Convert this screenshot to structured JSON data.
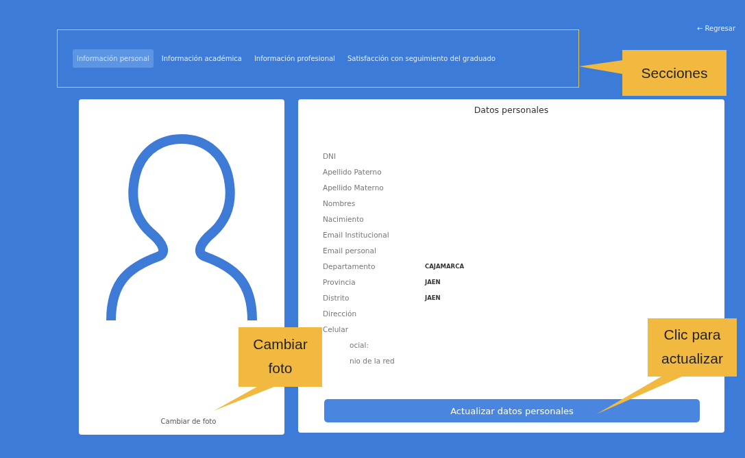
{
  "header": {
    "tabs": [
      {
        "label": "Información personal",
        "selected": true
      },
      {
        "label": "Información académica",
        "selected": false
      },
      {
        "label": "Información profesional",
        "selected": false
      },
      {
        "label": "Satisfacción con seguimiento del graduado",
        "selected": false
      }
    ],
    "back_link": "← Regresar"
  },
  "photo_panel": {
    "change_photo_link": "Cambiar de foto"
  },
  "personal_data": {
    "title": "Datos personales",
    "fields": [
      {
        "label": "DNI",
        "kind": "plain"
      },
      {
        "label": "Apellido Paterno",
        "kind": "plain"
      },
      {
        "label": "Apellido Materno",
        "kind": "plain"
      },
      {
        "label": "Nombres",
        "kind": "plain"
      },
      {
        "label": "Nacimiento",
        "kind": "plain"
      },
      {
        "label": "Email Institucional",
        "kind": "plain"
      },
      {
        "label": "Email personal",
        "kind": "plain"
      },
      {
        "label": "Departamento",
        "value": "CAJAMARCA",
        "kind": "plain"
      },
      {
        "label": "Provincia",
        "value": "JAEN",
        "kind": "plain"
      },
      {
        "label": "Distrito",
        "value": "JAEN",
        "kind": "plain"
      },
      {
        "label": "Dirección",
        "kind": "plain"
      },
      {
        "label": "Celular",
        "kind": "plain"
      },
      {
        "label": "ocial:",
        "kind": "partial"
      },
      {
        "label": "nio de la red",
        "kind": "partial"
      }
    ],
    "submit_button": "Actualizar datos personales"
  },
  "callouts": [
    {
      "lines": [
        "Secciones"
      ]
    },
    {
      "lines": [
        "Cambiar",
        "foto"
      ]
    },
    {
      "lines": [
        "Clic para",
        "actualizar"
      ]
    }
  ]
}
